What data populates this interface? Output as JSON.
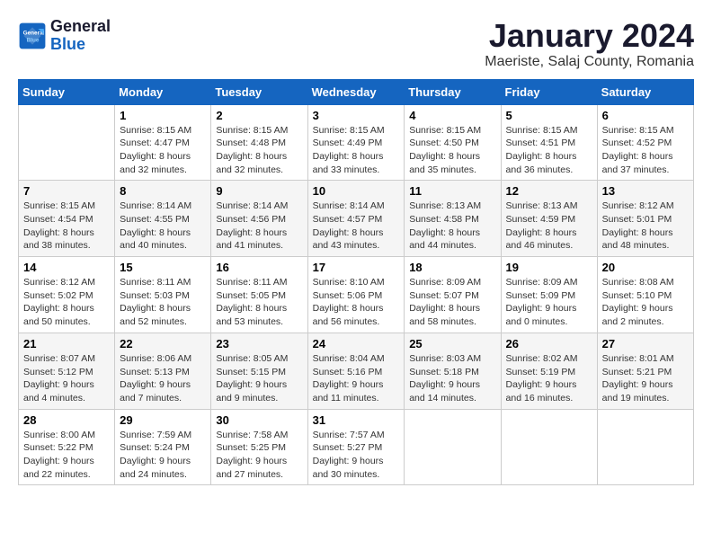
{
  "logo": {
    "line1": "General",
    "line2": "Blue"
  },
  "title": "January 2024",
  "location": "Maeriste, Salaj County, Romania",
  "days_of_week": [
    "Sunday",
    "Monday",
    "Tuesday",
    "Wednesday",
    "Thursday",
    "Friday",
    "Saturday"
  ],
  "weeks": [
    [
      {
        "day": "",
        "sunrise": "",
        "sunset": "",
        "daylight": ""
      },
      {
        "day": "1",
        "sunrise": "Sunrise: 8:15 AM",
        "sunset": "Sunset: 4:47 PM",
        "daylight": "Daylight: 8 hours and 32 minutes."
      },
      {
        "day": "2",
        "sunrise": "Sunrise: 8:15 AM",
        "sunset": "Sunset: 4:48 PM",
        "daylight": "Daylight: 8 hours and 32 minutes."
      },
      {
        "day": "3",
        "sunrise": "Sunrise: 8:15 AM",
        "sunset": "Sunset: 4:49 PM",
        "daylight": "Daylight: 8 hours and 33 minutes."
      },
      {
        "day": "4",
        "sunrise": "Sunrise: 8:15 AM",
        "sunset": "Sunset: 4:50 PM",
        "daylight": "Daylight: 8 hours and 35 minutes."
      },
      {
        "day": "5",
        "sunrise": "Sunrise: 8:15 AM",
        "sunset": "Sunset: 4:51 PM",
        "daylight": "Daylight: 8 hours and 36 minutes."
      },
      {
        "day": "6",
        "sunrise": "Sunrise: 8:15 AM",
        "sunset": "Sunset: 4:52 PM",
        "daylight": "Daylight: 8 hours and 37 minutes."
      }
    ],
    [
      {
        "day": "7",
        "sunrise": "Sunrise: 8:15 AM",
        "sunset": "Sunset: 4:54 PM",
        "daylight": "Daylight: 8 hours and 38 minutes."
      },
      {
        "day": "8",
        "sunrise": "Sunrise: 8:14 AM",
        "sunset": "Sunset: 4:55 PM",
        "daylight": "Daylight: 8 hours and 40 minutes."
      },
      {
        "day": "9",
        "sunrise": "Sunrise: 8:14 AM",
        "sunset": "Sunset: 4:56 PM",
        "daylight": "Daylight: 8 hours and 41 minutes."
      },
      {
        "day": "10",
        "sunrise": "Sunrise: 8:14 AM",
        "sunset": "Sunset: 4:57 PM",
        "daylight": "Daylight: 8 hours and 43 minutes."
      },
      {
        "day": "11",
        "sunrise": "Sunrise: 8:13 AM",
        "sunset": "Sunset: 4:58 PM",
        "daylight": "Daylight: 8 hours and 44 minutes."
      },
      {
        "day": "12",
        "sunrise": "Sunrise: 8:13 AM",
        "sunset": "Sunset: 4:59 PM",
        "daylight": "Daylight: 8 hours and 46 minutes."
      },
      {
        "day": "13",
        "sunrise": "Sunrise: 8:12 AM",
        "sunset": "Sunset: 5:01 PM",
        "daylight": "Daylight: 8 hours and 48 minutes."
      }
    ],
    [
      {
        "day": "14",
        "sunrise": "Sunrise: 8:12 AM",
        "sunset": "Sunset: 5:02 PM",
        "daylight": "Daylight: 8 hours and 50 minutes."
      },
      {
        "day": "15",
        "sunrise": "Sunrise: 8:11 AM",
        "sunset": "Sunset: 5:03 PM",
        "daylight": "Daylight: 8 hours and 52 minutes."
      },
      {
        "day": "16",
        "sunrise": "Sunrise: 8:11 AM",
        "sunset": "Sunset: 5:05 PM",
        "daylight": "Daylight: 8 hours and 53 minutes."
      },
      {
        "day": "17",
        "sunrise": "Sunrise: 8:10 AM",
        "sunset": "Sunset: 5:06 PM",
        "daylight": "Daylight: 8 hours and 56 minutes."
      },
      {
        "day": "18",
        "sunrise": "Sunrise: 8:09 AM",
        "sunset": "Sunset: 5:07 PM",
        "daylight": "Daylight: 8 hours and 58 minutes."
      },
      {
        "day": "19",
        "sunrise": "Sunrise: 8:09 AM",
        "sunset": "Sunset: 5:09 PM",
        "daylight": "Daylight: 9 hours and 0 minutes."
      },
      {
        "day": "20",
        "sunrise": "Sunrise: 8:08 AM",
        "sunset": "Sunset: 5:10 PM",
        "daylight": "Daylight: 9 hours and 2 minutes."
      }
    ],
    [
      {
        "day": "21",
        "sunrise": "Sunrise: 8:07 AM",
        "sunset": "Sunset: 5:12 PM",
        "daylight": "Daylight: 9 hours and 4 minutes."
      },
      {
        "day": "22",
        "sunrise": "Sunrise: 8:06 AM",
        "sunset": "Sunset: 5:13 PM",
        "daylight": "Daylight: 9 hours and 7 minutes."
      },
      {
        "day": "23",
        "sunrise": "Sunrise: 8:05 AM",
        "sunset": "Sunset: 5:15 PM",
        "daylight": "Daylight: 9 hours and 9 minutes."
      },
      {
        "day": "24",
        "sunrise": "Sunrise: 8:04 AM",
        "sunset": "Sunset: 5:16 PM",
        "daylight": "Daylight: 9 hours and 11 minutes."
      },
      {
        "day": "25",
        "sunrise": "Sunrise: 8:03 AM",
        "sunset": "Sunset: 5:18 PM",
        "daylight": "Daylight: 9 hours and 14 minutes."
      },
      {
        "day": "26",
        "sunrise": "Sunrise: 8:02 AM",
        "sunset": "Sunset: 5:19 PM",
        "daylight": "Daylight: 9 hours and 16 minutes."
      },
      {
        "day": "27",
        "sunrise": "Sunrise: 8:01 AM",
        "sunset": "Sunset: 5:21 PM",
        "daylight": "Daylight: 9 hours and 19 minutes."
      }
    ],
    [
      {
        "day": "28",
        "sunrise": "Sunrise: 8:00 AM",
        "sunset": "Sunset: 5:22 PM",
        "daylight": "Daylight: 9 hours and 22 minutes."
      },
      {
        "day": "29",
        "sunrise": "Sunrise: 7:59 AM",
        "sunset": "Sunset: 5:24 PM",
        "daylight": "Daylight: 9 hours and 24 minutes."
      },
      {
        "day": "30",
        "sunrise": "Sunrise: 7:58 AM",
        "sunset": "Sunset: 5:25 PM",
        "daylight": "Daylight: 9 hours and 27 minutes."
      },
      {
        "day": "31",
        "sunrise": "Sunrise: 7:57 AM",
        "sunset": "Sunset: 5:27 PM",
        "daylight": "Daylight: 9 hours and 30 minutes."
      },
      {
        "day": "",
        "sunrise": "",
        "sunset": "",
        "daylight": ""
      },
      {
        "day": "",
        "sunrise": "",
        "sunset": "",
        "daylight": ""
      },
      {
        "day": "",
        "sunrise": "",
        "sunset": "",
        "daylight": ""
      }
    ]
  ]
}
